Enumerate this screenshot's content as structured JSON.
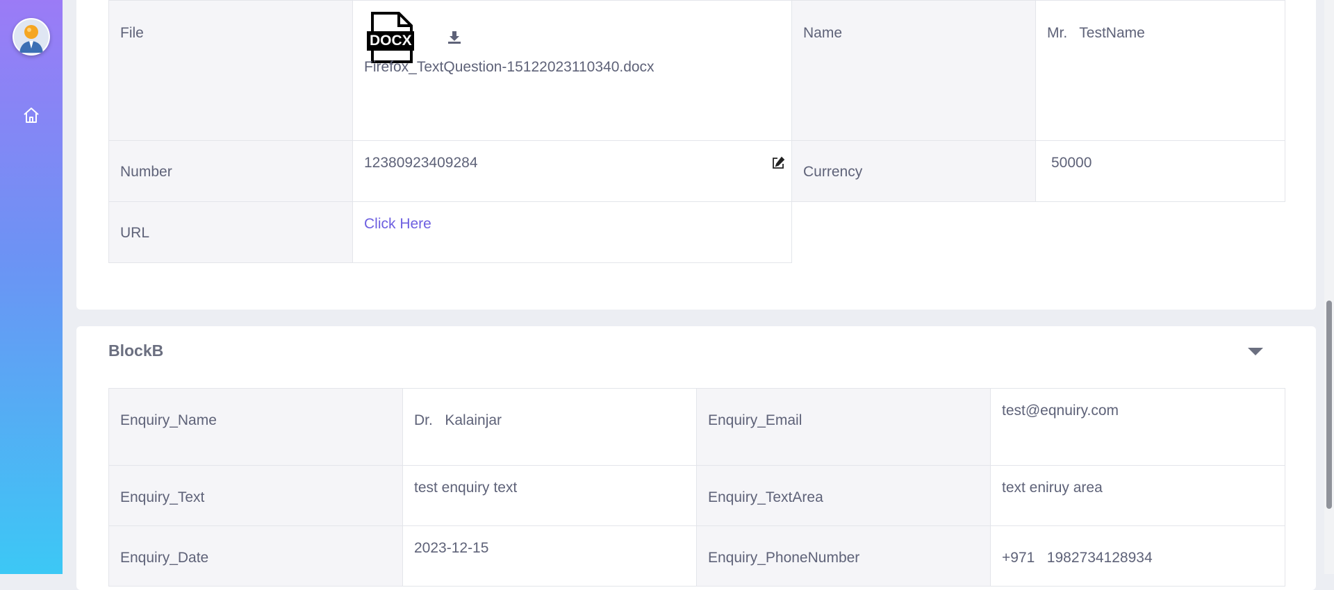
{
  "sidebar": {
    "avatar_icon": "user-avatar-icon",
    "home_icon": "home-icon"
  },
  "block_a": {
    "rows": [
      {
        "label_1": "File",
        "file_badge": "DOCX",
        "file_name": "Firefox_TextQuestion-15122023110340.docx",
        "label_2": "Name",
        "value_2": "Mr.   TestName"
      },
      {
        "label_1": "Number",
        "value_1": "12380923409284",
        "label_2": "Currency",
        "value_2": "50000"
      },
      {
        "label_1": "URL",
        "value_1": "Click Here"
      }
    ]
  },
  "block_b": {
    "title": "BlockB",
    "rows": [
      {
        "label_1": "Enquiry_Name",
        "value_1": "Dr.   Kalainjar",
        "label_2": "Enquiry_Email",
        "value_2": "test@eqnuiry.com"
      },
      {
        "label_1": "Enquiry_Text",
        "value_1": "test enquiry text",
        "label_2": "Enquiry_TextArea",
        "value_2": "text eniruy area"
      },
      {
        "label_1": "Enquiry_Date",
        "value_1": "2023-12-15",
        "label_2": "Enquiry_PhoneNumber",
        "value_2": "+971   1982734128934"
      }
    ]
  },
  "colors": {
    "accent": "#6d5fe0",
    "label_bg": "#f5f5f8",
    "text": "#5e6278"
  }
}
